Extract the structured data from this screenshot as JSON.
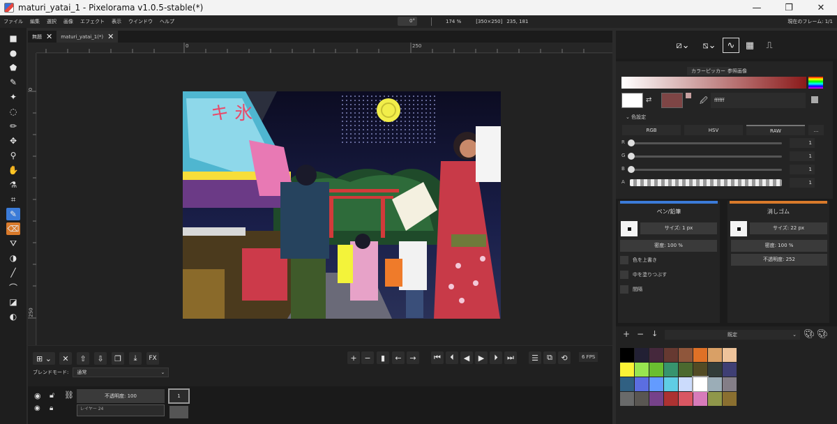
{
  "window": {
    "title": "maturi_yatai_1 - Pixelorama v1.0.5-stable(*)",
    "min": "—",
    "max": "❐",
    "close": "✕"
  },
  "menu": {
    "items": [
      "ファイル",
      "編集",
      "選択",
      "画像",
      "エフェクト",
      "表示",
      "ウインドウ",
      "ヘルプ"
    ]
  },
  "viewbar": {
    "rotation": "0°",
    "zoom": "174 %",
    "canvas_size": "[350×250]",
    "cursor_pos": "235, 181",
    "frame_label": "現在のフレーム: 1/1"
  },
  "tabs": [
    {
      "label": "無題"
    },
    {
      "label": "maturi_yatai_1(*)"
    }
  ],
  "rulers": {
    "h0": "0",
    "h250": "250",
    "v0": "0",
    "v250": "250"
  },
  "tools": [
    {
      "name": "rect-select-icon",
      "glyph": "■"
    },
    {
      "name": "ellipse-select-icon",
      "glyph": "●"
    },
    {
      "name": "polygon-select-icon",
      "glyph": "⬟"
    },
    {
      "name": "color-select-icon",
      "glyph": "✎"
    },
    {
      "name": "magic-wand-icon",
      "glyph": "✦"
    },
    {
      "name": "lasso-icon",
      "glyph": "◌"
    },
    {
      "name": "paint-select-icon",
      "glyph": "✏"
    },
    {
      "name": "move-icon",
      "glyph": "✥"
    },
    {
      "name": "zoom-icon",
      "glyph": "⚲"
    },
    {
      "name": "pan-icon",
      "glyph": "✋"
    },
    {
      "name": "color-picker-icon",
      "glyph": "⚗"
    },
    {
      "name": "crop-icon",
      "glyph": "⌗"
    },
    {
      "name": "pencil-icon",
      "glyph": "✎"
    },
    {
      "name": "eraser-icon",
      "glyph": "⌫"
    },
    {
      "name": "bucket-icon",
      "glyph": "⛛"
    },
    {
      "name": "shading-icon",
      "glyph": "◑"
    },
    {
      "name": "line-icon",
      "glyph": "╱"
    },
    {
      "name": "curve-icon",
      "glyph": "⌒"
    },
    {
      "name": "gradient-icon",
      "glyph": "◪"
    },
    {
      "name": "circle-shape-icon",
      "glyph": "◐"
    }
  ],
  "timeline": {
    "blend_label": "ブレンドモード:",
    "blend_value": "通常",
    "fps": "6 FPS",
    "layer_opacity": "不透明度: 100",
    "layer2_name": "レイヤー 24",
    "frame_num": "1",
    "fx_label": "FX"
  },
  "colorpanel": {
    "tab_picker": "カラーピッカー",
    "tab_reference": "参照画像",
    "hex": "ffffff",
    "settings_label": "色設定",
    "modes": [
      "RGB",
      "HSV",
      "RAW",
      "..."
    ],
    "sliders": [
      {
        "label": "R",
        "value": "1"
      },
      {
        "label": "G",
        "value": "1"
      },
      {
        "label": "B",
        "value": "1"
      },
      {
        "label": "A",
        "value": "1"
      }
    ],
    "primary": "#ffffff",
    "secondary": "#7e4545"
  },
  "left_tool": {
    "title": "ペン/鉛筆",
    "size": "サイズ: 1 px",
    "density": "密度: 100 %",
    "opt1": "色を上書き",
    "opt2": "中を塗りつぶす",
    "opt3": "間隔",
    "accent": "#3b7bd8"
  },
  "right_tool": {
    "title": "消しゴム",
    "size": "サイズ: 22 px",
    "density": "密度: 100 %",
    "opacity": "不透明度: 252",
    "accent": "#d97a2b"
  },
  "palette": {
    "name": "既定",
    "colors": [
      "#000000",
      "#222034",
      "#45283c",
      "#663931",
      "#8f563b",
      "#df7126",
      "#d9a066",
      "#eec39a",
      "#fbf236",
      "#99e550",
      "#6abe30",
      "#37946e",
      "#4b692f",
      "#524b24",
      "#323c39",
      "#3f3f74",
      "#306082",
      "#5b6ee1",
      "#639bff",
      "#5fcde4",
      "#cbdbfc",
      "#ffffff",
      "#9badb7",
      "#847e87",
      "#696a6a",
      "#595652",
      "#76428a",
      "#ac3232",
      "#d95763",
      "#d77bba",
      "#8f974a",
      "#8a6f30"
    ]
  }
}
